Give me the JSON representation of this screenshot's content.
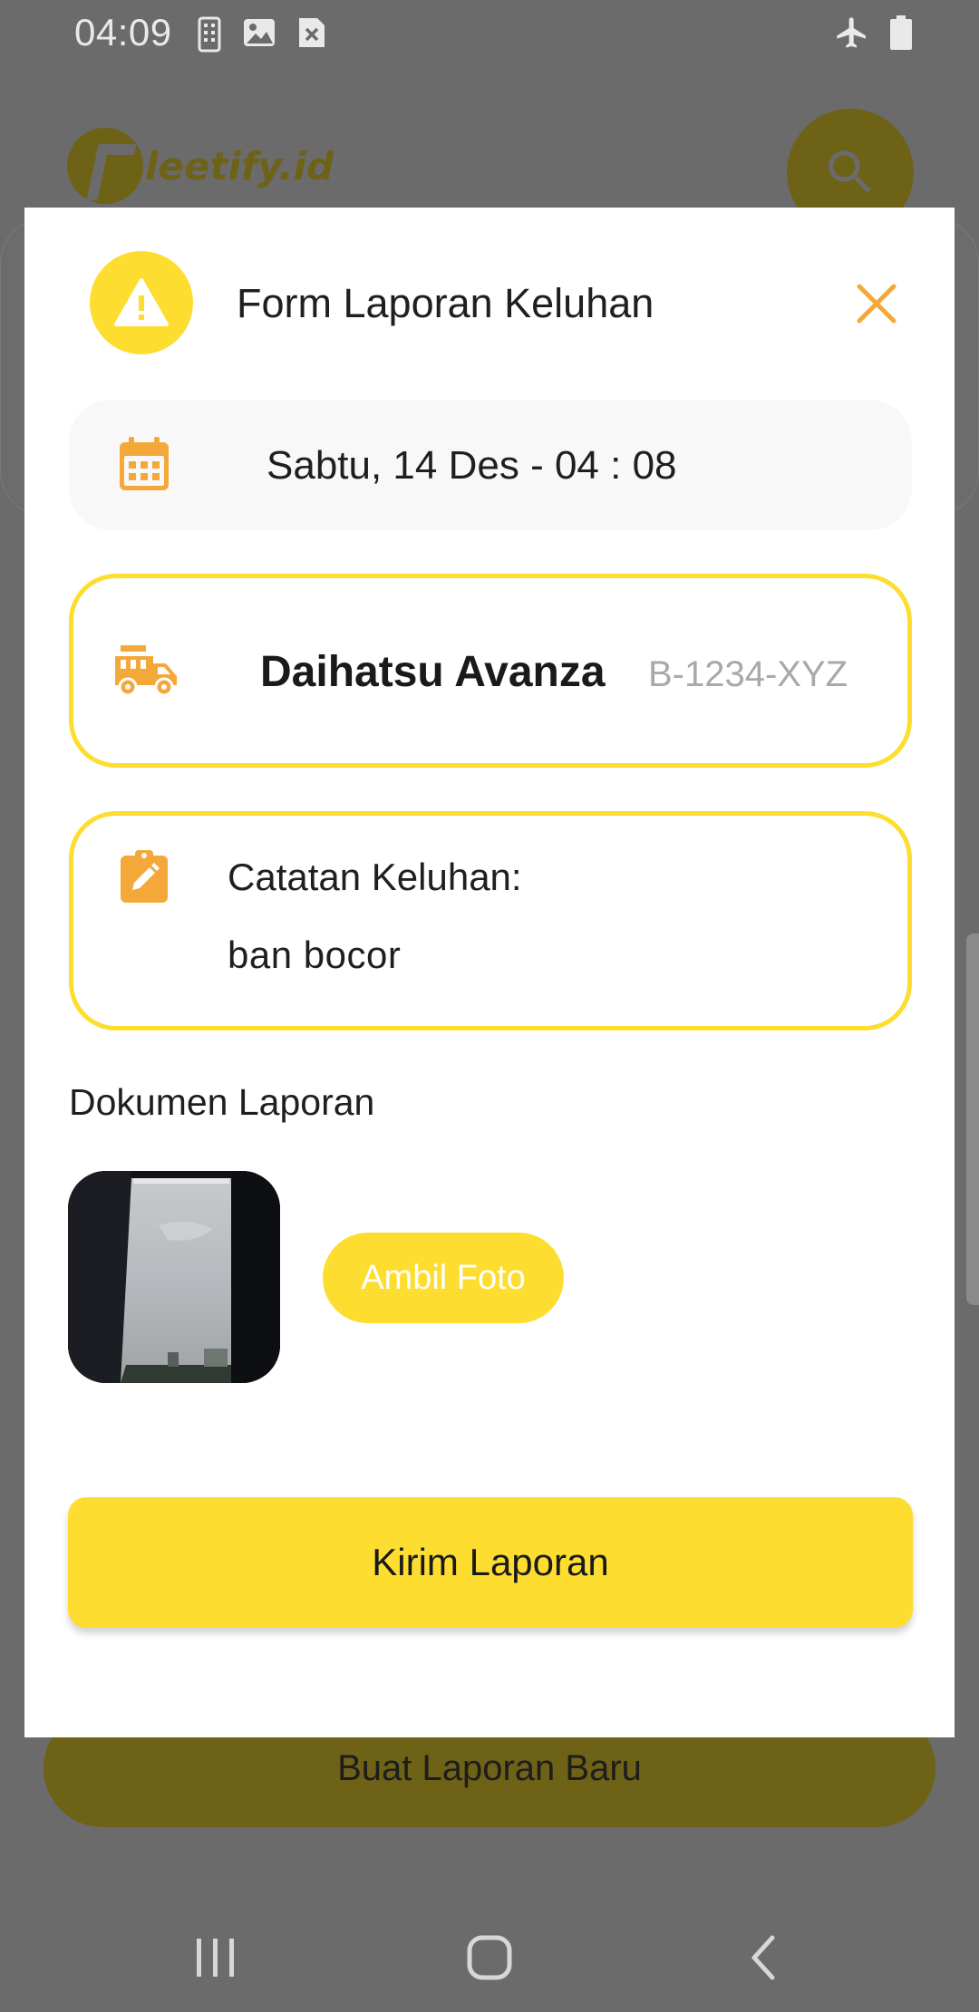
{
  "status_bar": {
    "time": "04:09",
    "icons": [
      "sim-icon",
      "image-icon",
      "close-box-icon",
      "airplane-icon",
      "battery-icon"
    ]
  },
  "background": {
    "logo_text": "leetify.id",
    "logo_letter": "F",
    "new_report_label": "Buat Laporan Baru"
  },
  "modal": {
    "title": "Form Laporan Keluhan",
    "date_time": "Sabtu, 14 Des - 04 : 08",
    "vehicle": {
      "name": "Daihatsu Avanza",
      "plate": "B-1234-XYZ"
    },
    "notes": {
      "label": "Catatan Keluhan:",
      "value": "ban bocor"
    },
    "documents_title": "Dokumen Laporan",
    "take_photo_label": "Ambil Foto",
    "submit_label": "Kirim Laporan"
  },
  "colors": {
    "accent": "#fddd2f",
    "icon_orange": "#f5a83a",
    "overlay": "#6b6b6b"
  }
}
